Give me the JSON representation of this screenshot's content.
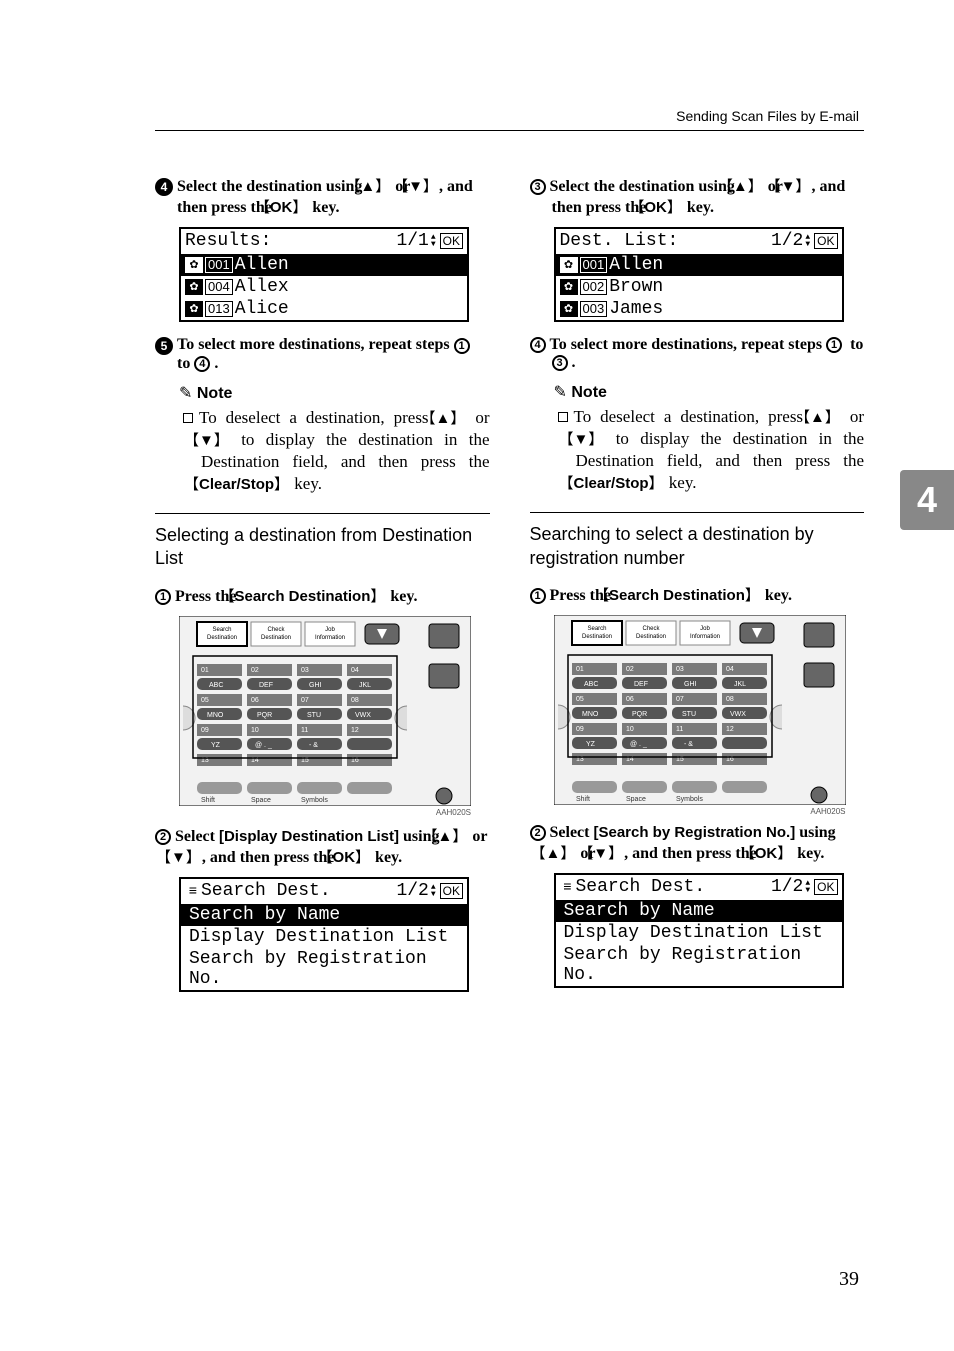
{
  "header": {
    "breadcrumb": "Sending Scan Files by E-mail"
  },
  "side_tab": "4",
  "page_number": "39",
  "left": {
    "step4": {
      "num": "4",
      "text1": "Select the destination using ",
      "key_up": "▲",
      "or": " or ",
      "key_down": "▼",
      "text2": ", and then press the ",
      "key_ok": "OK",
      "text3": " key."
    },
    "lcd1": {
      "title": "Results:",
      "page": "1/1",
      "ok": "OK",
      "rows": [
        {
          "code": "001",
          "name": "Allen",
          "selected": true
        },
        {
          "code": "004",
          "name": "Allex",
          "selected": false
        },
        {
          "code": "013",
          "name": "Alice",
          "selected": false
        }
      ]
    },
    "step5": {
      "num": "5",
      "text1": "To select more destinations, repeat steps ",
      "ref1": "1",
      "to": " to ",
      "ref2": "4",
      "period": "."
    },
    "note1": {
      "heading": "Note",
      "body1": "To deselect a destination, press ",
      "key_up": "▲",
      "or": " or ",
      "key_down": "▼",
      "body2": " to display the destination in the Destination field, and then press the ",
      "key_clear": "Clear/Stop",
      "body3": " key."
    },
    "section_title": "Selecting a destination from Destination List",
    "step1b": {
      "num": "1",
      "text1": "Press the ",
      "key_sd": "Search Destination",
      "text2": " key."
    },
    "panel_caption": "AAH020S",
    "panel_top_buttons": [
      "Search\nDestination",
      "Check\nDestination",
      "Job\nInformation"
    ],
    "panel_key_labels": [
      [
        "01",
        "02",
        "03",
        "04"
      ],
      [
        "ABC",
        "DEF",
        "GHI",
        "JKL"
      ],
      [
        "05",
        "06",
        "07",
        "08"
      ],
      [
        "MNO",
        "PQR",
        "STU",
        "VWX"
      ],
      [
        "09",
        "10",
        "11",
        "12"
      ],
      [
        "YZ",
        "@ . _",
        "- &",
        ""
      ],
      [
        "13",
        "14",
        "15",
        "16"
      ],
      [
        "Shift",
        "Space",
        "Symbols",
        ""
      ]
    ],
    "step2b": {
      "num": "2",
      "text1": "Select ",
      "label": "[Display Destination List]",
      "text2": " using ",
      "key_up": "▲",
      "or": " or ",
      "key_down": "▼",
      "text3": ", and then press the ",
      "key_ok": "OK",
      "text4": " key."
    },
    "lcd2": {
      "title": "Search Dest.",
      "page": "1/2",
      "ok": "OK",
      "rows": [
        "Search by Name",
        "Display Destination List",
        "Search by Registration No."
      ],
      "selected_index": 0,
      "title_icon": "≡"
    }
  },
  "right": {
    "step3": {
      "num": "3",
      "text1": "Select the destination using ",
      "key_up": "▲",
      "or": " or ",
      "key_down": "▼",
      "text2": ", and then press the ",
      "key_ok": "OK",
      "text3": " key."
    },
    "lcd1": {
      "title": "Dest. List:",
      "page": "1/2",
      "ok": "OK",
      "rows": [
        {
          "code": "001",
          "name": "Allen",
          "selected": true
        },
        {
          "code": "002",
          "name": "Brown",
          "selected": false
        },
        {
          "code": "003",
          "name": "James",
          "selected": false
        }
      ]
    },
    "step4": {
      "num": "4",
      "text1": "To select more destinations, repeat steps ",
      "ref1": "1",
      "to": " to ",
      "ref2": "3",
      "period": "."
    },
    "note1": {
      "heading": "Note",
      "body1": "To deselect a destination, press ",
      "key_up": "▲",
      "or": " or ",
      "key_down": "▼",
      "body2": " to display the destination in the Destination field, and then press the ",
      "key_clear": "Clear/Stop",
      "body3": " key."
    },
    "section_title": "Searching to select a destination by registration number",
    "step1b": {
      "num": "1",
      "text1": "Press the ",
      "key_sd": "Search Destination",
      "text2": " key."
    },
    "panel_caption": "AAH020S",
    "step2b": {
      "num": "2",
      "text1": "Select ",
      "label": "[Search by Registration No.]",
      "text2": " using ",
      "key_up": "▲",
      "or": " or ",
      "key_down": "▼",
      "text3": ", and then press the ",
      "key_ok": "OK",
      "text4": " key."
    },
    "lcd2": {
      "title": "Search Dest.",
      "page": "1/2",
      "ok": "OK",
      "rows": [
        "Search by Name",
        "Display Destination List",
        "Search by Registration No."
      ],
      "selected_index": 0,
      "title_icon": "≡"
    }
  }
}
